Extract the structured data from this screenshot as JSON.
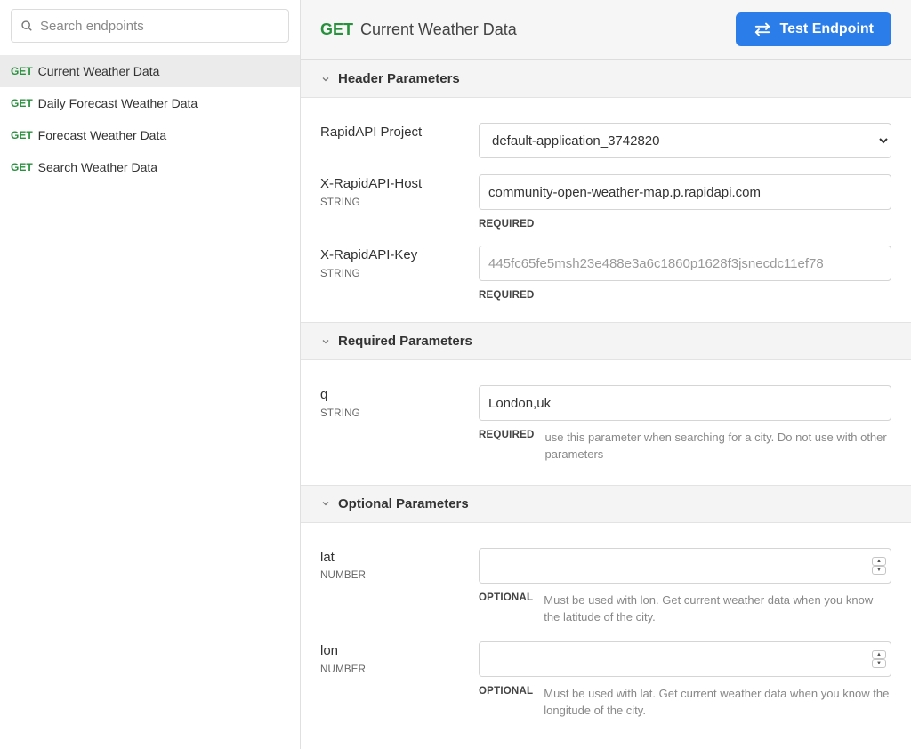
{
  "sidebar": {
    "search_placeholder": "Search endpoints",
    "items": [
      {
        "method": "GET",
        "name": "Current Weather Data",
        "active": true
      },
      {
        "method": "GET",
        "name": "Daily Forecast Weather Data",
        "active": false
      },
      {
        "method": "GET",
        "name": "Forecast Weather Data",
        "active": false
      },
      {
        "method": "GET",
        "name": "Search Weather Data",
        "active": false
      }
    ]
  },
  "header": {
    "method": "GET",
    "title": "Current Weather Data",
    "test_button": "Test Endpoint"
  },
  "sections": {
    "header_params_title": "Header Parameters",
    "required_params_title": "Required Parameters",
    "optional_params_title": "Optional Parameters"
  },
  "labels": {
    "required": "REQUIRED",
    "optional": "OPTIONAL",
    "type_string": "STRING",
    "type_number": "NUMBER"
  },
  "header_params": {
    "project": {
      "name": "RapidAPI Project",
      "selected": "default-application_3742820"
    },
    "host": {
      "name": "X-RapidAPI-Host",
      "value": "community-open-weather-map.p.rapidapi.com"
    },
    "key": {
      "name": "X-RapidAPI-Key",
      "placeholder": "445fc65fe5msh23e488e3a6c1860p1628f3jsnecdc11ef78"
    }
  },
  "required_params": {
    "q": {
      "name": "q",
      "value": "London,uk",
      "desc": "use this parameter when searching for a city. Do not use with other parameters"
    }
  },
  "optional_params": {
    "lat": {
      "name": "lat",
      "value": "",
      "desc": "Must be used with lon. Get current weather data when you know the latitude of the city."
    },
    "lon": {
      "name": "lon",
      "value": "",
      "desc": "Must be used with lat. Get current weather data when you know the longitude of the city."
    }
  }
}
